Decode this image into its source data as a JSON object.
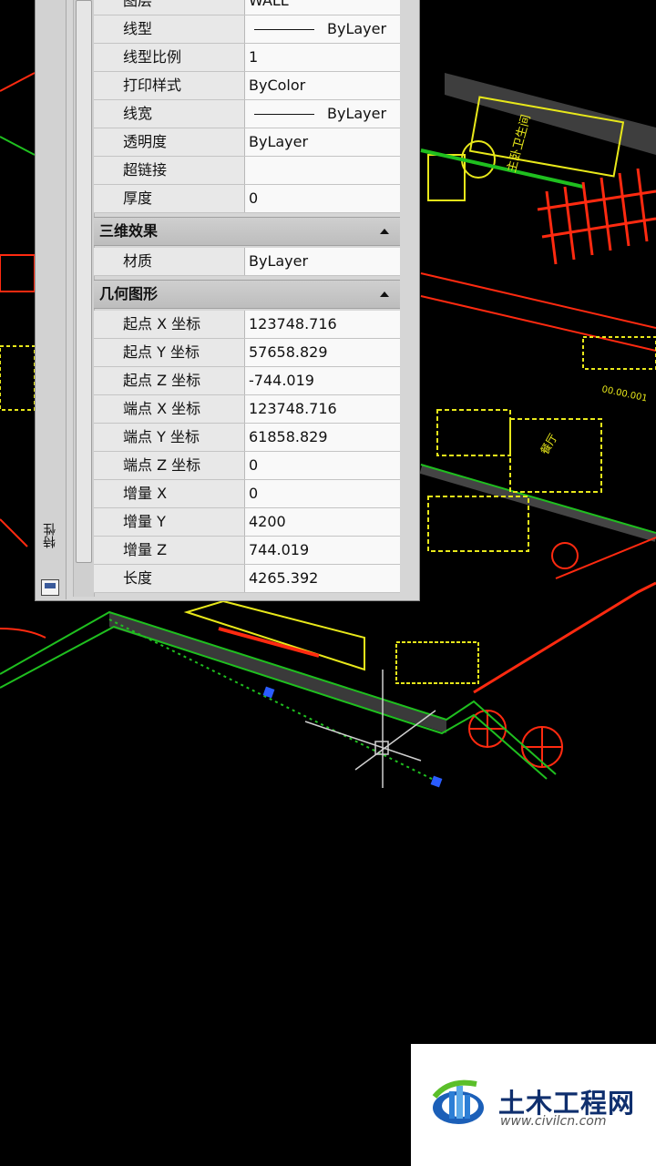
{
  "properties_panel": {
    "title": "特性",
    "general": {
      "rows": [
        {
          "label": "图层",
          "value": "WALL"
        },
        {
          "label": "线型",
          "value": "ByLayer",
          "line_sample": true
        },
        {
          "label": "线型比例",
          "value": "1"
        },
        {
          "label": "打印样式",
          "value": "ByColor"
        },
        {
          "label": "线宽",
          "value": "ByLayer",
          "line_sample": true
        },
        {
          "label": "透明度",
          "value": "ByLayer"
        },
        {
          "label": "超链接",
          "value": ""
        },
        {
          "label": "厚度",
          "value": "0"
        }
      ]
    },
    "threed": {
      "title": "三维效果",
      "rows": [
        {
          "label": "材质",
          "value": "ByLayer"
        }
      ]
    },
    "geometry": {
      "title": "几何图形",
      "rows": [
        {
          "label": "起点 X 坐标",
          "value": "123748.716"
        },
        {
          "label": "起点 Y 坐标",
          "value": "57658.829"
        },
        {
          "label": "起点 Z 坐标",
          "value": "-744.019"
        },
        {
          "label": "端点 X 坐标",
          "value": "123748.716"
        },
        {
          "label": "端点 Y 坐标",
          "value": "61858.829"
        },
        {
          "label": "端点 Z 坐标",
          "value": "0"
        },
        {
          "label": "增量 X",
          "value": "0"
        },
        {
          "label": "增量 Y",
          "value": "4200"
        },
        {
          "label": "增量 Z",
          "value": "744.019"
        },
        {
          "label": "长度",
          "value": "4265.392"
        }
      ]
    }
  },
  "drawing_text": {
    "room_1": "主卧卫生间",
    "room_2": "餐厅",
    "label": "00.00.001"
  },
  "watermark": {
    "name": "土木工程网",
    "url": "www.civilcn.com"
  },
  "colors": {
    "canvas_bg": "#000000",
    "wall_green": "#1fbf1f",
    "line_yellow": "#e8e81a",
    "line_red": "#ff2a10",
    "wall_gray": "#444444",
    "grip_blue": "#2a5cff",
    "panel_bg": "#d6d6d6",
    "logo_blue": "#0f2f6e"
  }
}
